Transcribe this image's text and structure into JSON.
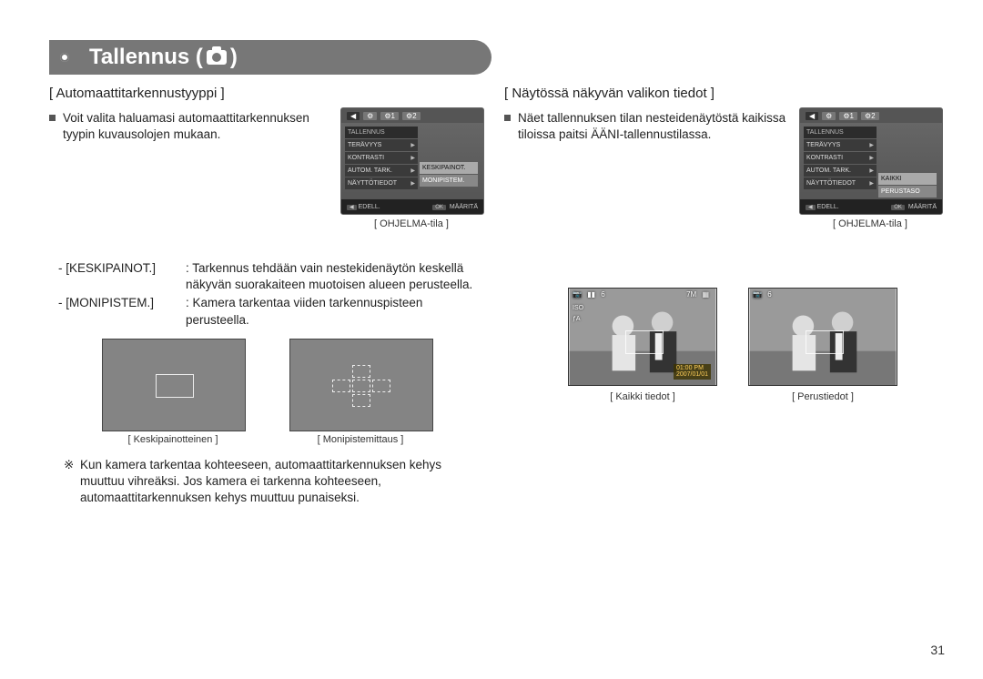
{
  "header": {
    "title_prefix": "Tallennus (",
    "title_suffix": " )"
  },
  "left": {
    "section_title": "[ Automaattitarkennustyyppi ]",
    "bullet_text": "Voit valita haluamasi automaattitarkennuksen tyypin kuvausolojen mukaan.",
    "menu_caption": "[ OHJELMA-tila ]",
    "definitions": [
      {
        "key": "- [KESKIPAINOT.]",
        "text": ": Tarkennus tehdään vain nestekidenäytön keskellä näkyvän suorakaiteen muotoisen alueen perusteella."
      },
      {
        "key": "- [MONIPISTEM.]",
        "text": ": Kamera tarkentaa viiden tarkennuspisteen perusteella."
      }
    ],
    "focus_captions": {
      "center": "[ Keskipainotteinen ]",
      "multi": "[ Monipistemittaus ]"
    },
    "note_mark": "※",
    "note_text": "Kun kamera tarkentaa kohteeseen, automaattitarkennuksen kehys muuttuu vihreäksi. Jos kamera ei tarkenna kohteeseen, automaattitarkennuksen kehys muuttuu punaiseksi."
  },
  "right": {
    "section_title": "[ Näytössä näkyvän valikon tiedot ]",
    "bullet_text": "Näet tallennuksen tilan nesteidenäytöstä kaikissa tiloissa paitsi ÄÄNI-tallennustilassa.",
    "menu_caption": "[ OHJELMA-tila ]",
    "photo_captions": {
      "full": "[ Kaikki tiedot ]",
      "basic": "[ Perustiedot ]"
    },
    "hud": {
      "shots_remaining": "6",
      "size": "7M",
      "iso_label": "ISO",
      "flash": "ƒA",
      "time": "01:00 PM",
      "date": "2007/01/01"
    }
  },
  "menu_left": {
    "section": "TALLENNUS",
    "items": [
      "TERÄVYYS",
      "KONTRASTI",
      "AUTOM. TARK.",
      "NÄYTTÖTIEDOT"
    ],
    "sub_items": [
      "KESKIPAINOT.",
      "MONIPISTEM."
    ],
    "foot_back": "EDELL.",
    "foot_ok": "OK",
    "foot_set": "MÄÄRITÄ"
  },
  "menu_right": {
    "section": "TALLENNUS",
    "items": [
      "TERÄVYYS",
      "KONTRASTI",
      "AUTOM. TARK.",
      "NÄYTTÖTIEDOT"
    ],
    "sub_items": [
      "KAIKKI",
      "PERUSTASO"
    ],
    "foot_back": "EDELL.",
    "foot_ok": "OK",
    "foot_set": "MÄÄRITÄ"
  },
  "page_number": "31"
}
